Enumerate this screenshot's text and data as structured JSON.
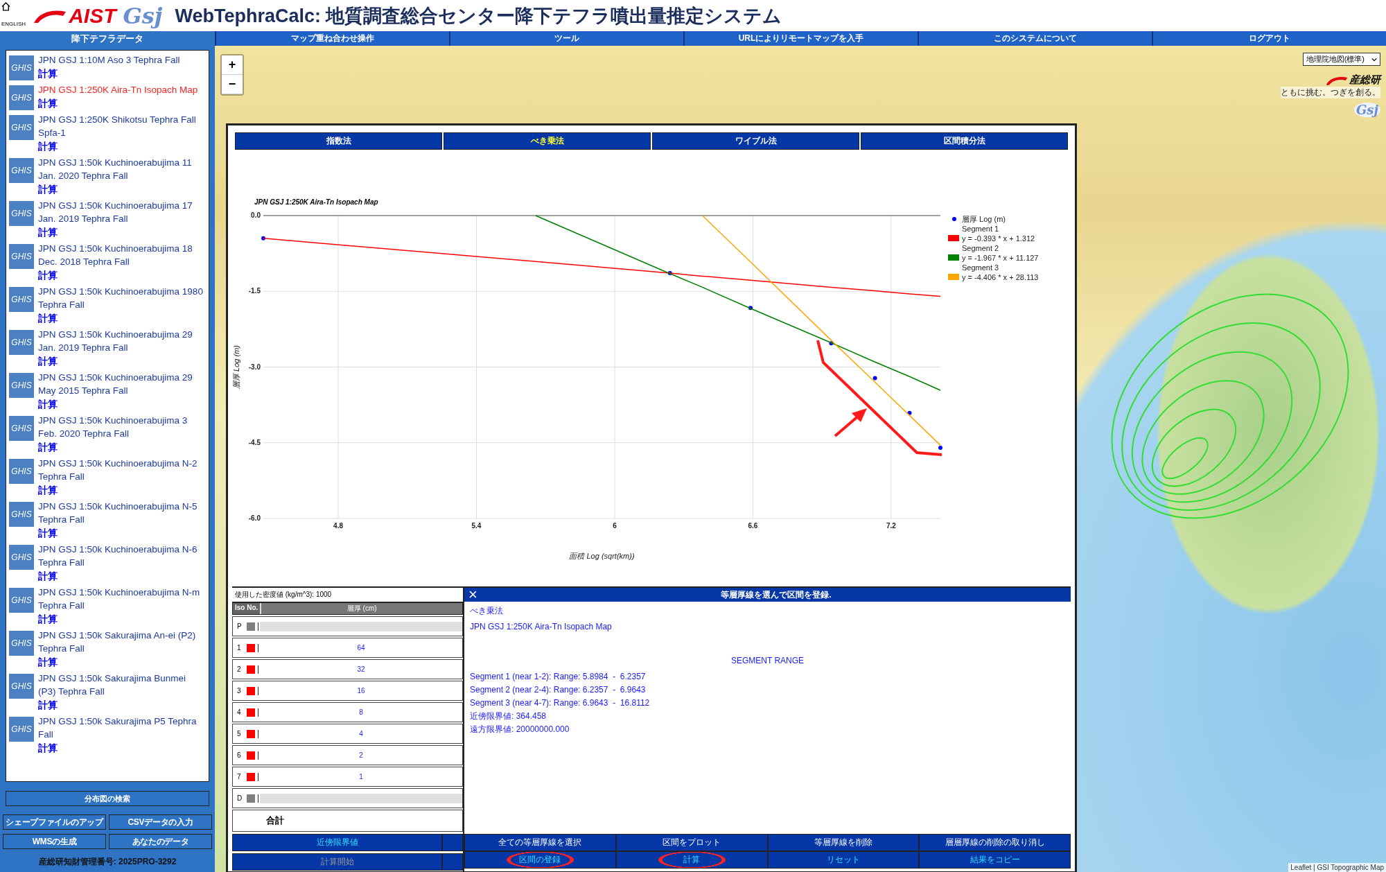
{
  "header": {
    "home_label": "ENGLISH",
    "aist_logo": "AIST",
    "gsj_logo": "Gsj",
    "title": "WebTephraCalc: 地質調査総合センター降下テフラ噴出量推定システム"
  },
  "nav": [
    "マップ重ね合わせ操作",
    "ツール",
    "URLによりリモートマップを入手",
    "このシステムについて",
    "ログアウト"
  ],
  "sidebar": {
    "title": "降下テフラデータ",
    "items": [
      {
        "badge": "GHIS",
        "name": "JPN GSJ 1:10M Aso 3 Tephra Fall",
        "action": "計算",
        "selected": false
      },
      {
        "badge": "GHIS",
        "name": "JPN GSJ 1:250K Aira-Tn Isopach Map",
        "action": "計算",
        "selected": true
      },
      {
        "badge": "GHIS",
        "name": "JPN GSJ 1:250K Shikotsu Tephra Fall Spfa-1",
        "action": "計算",
        "selected": false
      },
      {
        "badge": "GHIS",
        "name": "JPN GSJ 1:50k Kuchinoerabujima 11 Jan. 2020 Tephra Fall",
        "action": "計算",
        "selected": false
      },
      {
        "badge": "GHIS",
        "name": "JPN GSJ 1:50k Kuchinoerabujima 17 Jan. 2019 Tephra Fall",
        "action": "計算",
        "selected": false
      },
      {
        "badge": "GHIS",
        "name": "JPN GSJ 1:50k Kuchinoerabujima 18 Dec. 2018 Tephra Fall",
        "action": "計算",
        "selected": false
      },
      {
        "badge": "GHIS",
        "name": "JPN GSJ 1:50k Kuchinoerabujima 1980 Tephra Fall",
        "action": "計算",
        "selected": false
      },
      {
        "badge": "GHIS",
        "name": "JPN GSJ 1:50k Kuchinoerabujima 29 Jan. 2019 Tephra Fall",
        "action": "計算",
        "selected": false
      },
      {
        "badge": "GHIS",
        "name": "JPN GSJ 1:50k Kuchinoerabujima 29 May 2015 Tephra Fall",
        "action": "計算",
        "selected": false
      },
      {
        "badge": "GHIS",
        "name": "JPN GSJ 1:50k Kuchinoerabujima 3 Feb. 2020 Tephra Fall",
        "action": "計算",
        "selected": false
      },
      {
        "badge": "GHIS",
        "name": "JPN GSJ 1:50k Kuchinoerabujima N-2 Tephra Fall",
        "action": "計算",
        "selected": false
      },
      {
        "badge": "GHIS",
        "name": "JPN GSJ 1:50k Kuchinoerabujima N-5 Tephra Fall",
        "action": "計算",
        "selected": false
      },
      {
        "badge": "GHIS",
        "name": "JPN GSJ 1:50k Kuchinoerabujima N-6 Tephra Fall",
        "action": "計算",
        "selected": false
      },
      {
        "badge": "GHIS",
        "name": "JPN GSJ 1:50k Kuchinoerabujima N-m Tephra Fall",
        "action": "計算",
        "selected": false
      },
      {
        "badge": "GHIS",
        "name": "JPN GSJ 1:50k Sakurajima An-ei (P2) Tephra Fall",
        "action": "計算",
        "selected": false
      },
      {
        "badge": "GHIS",
        "name": "JPN GSJ 1:50k Sakurajima Bunmei (P3) Tephra Fall",
        "action": "計算",
        "selected": false
      },
      {
        "badge": "GHIS",
        "name": "JPN GSJ 1:50k Sakurajima P5 Tephra Fall",
        "action": "計算",
        "selected": false
      }
    ],
    "search_button": "分布図の検索",
    "buttons": [
      "シェープファイルのアップ",
      "CSVデータの入力",
      "WMSの生成",
      "あなたのデータ"
    ],
    "footer": "産総研知財管理番号: 2025PRO-3292"
  },
  "map": {
    "zoom_in": "+",
    "zoom_out": "−",
    "layer_select": "地理院地図(標準)",
    "logo_text": "産総研",
    "logo_tagline": "ともに挑む。つぎを創る。",
    "gsj_logo": "Gsj",
    "attribution": "Leaflet | GSI Topographic Map"
  },
  "dialog": {
    "tabs": [
      {
        "label": "指数法",
        "selected": false
      },
      {
        "label": "べき乗法",
        "selected": true
      },
      {
        "label": "ワイブル法",
        "selected": false
      },
      {
        "label": "区間積分法",
        "selected": false
      }
    ],
    "chart_data": {
      "type": "line",
      "title": "JPN GSJ 1:250K Aira-Tn Isopach Map",
      "xlabel": "面積 Log (sqrt(km))",
      "ylabel": "層厚 Log (m)",
      "grid": true,
      "legend": "right",
      "x": [
        4.475,
        5.657,
        6.24,
        6.381,
        6.59,
        6.94,
        7.13,
        7.28,
        7.414
      ],
      "series": [
        {
          "name": "層厚 Log (m)",
          "color": "#0000ff",
          "type": "scatter",
          "marker": "circle",
          "values": [
            -0.45,
            null,
            -1.14,
            null,
            -1.83,
            -2.53,
            -3.22,
            -3.91,
            -4.6
          ]
        },
        {
          "name": "y = -0.393 * x + 1.312",
          "color": "#ff0000",
          "values": [
            -0.45,
            -0.91,
            -1.14,
            -1.2,
            -1.28,
            -1.42,
            -1.49,
            -1.55,
            -1.6
          ]
        },
        {
          "name": "y = -1.967 * x + 11.127",
          "color": "#008000",
          "values": [
            null,
            0,
            -1.15,
            -1.42,
            -1.84,
            -2.52,
            -2.9,
            -3.19,
            -3.46
          ]
        },
        {
          "name": "y = -4.406 * x + 28.113",
          "color": "#ffa500",
          "values": [
            null,
            null,
            null,
            0,
            -0.92,
            -2.47,
            -3.3,
            -3.96,
            -4.55
          ]
        }
      ],
      "xlim": [
        4.475,
        7.414
      ],
      "ylim": [
        -6,
        0
      ],
      "xticks": [
        4.8,
        5.4,
        6.0,
        6.6,
        7.2
      ],
      "yticks": [
        {
          "value": 0,
          "label": "0.0"
        },
        {
          "value": -1.5,
          "label": "-1.5"
        },
        {
          "value": -3,
          "label": "-3.0"
        },
        {
          "value": -4.5,
          "label": "-4.5"
        },
        {
          "value": -6,
          "label": "-6.0"
        }
      ]
    },
    "legend_headings": [
      "Segment 1",
      "Segment 2",
      "Segment 3"
    ],
    "density_label": "使用した密度値 (kg/m^3): 1000",
    "columns": [
      "Iso No.",
      "層厚 (cm)"
    ],
    "rows": [
      {
        "iso": "P",
        "kind": "limit",
        "color": "#808080"
      },
      {
        "iso": "1",
        "kind": "data",
        "color": "#ff0000",
        "thickness": "64"
      },
      {
        "iso": "2",
        "kind": "data",
        "color": "#ff0000",
        "thickness": "32"
      },
      {
        "iso": "3",
        "kind": "data",
        "color": "#ff0000",
        "thickness": "16"
      },
      {
        "iso": "4",
        "kind": "data",
        "color": "#ff0000",
        "thickness": "8"
      },
      {
        "iso": "5",
        "kind": "data",
        "color": "#ff0000",
        "thickness": "4"
      },
      {
        "iso": "6",
        "kind": "data",
        "color": "#ff0000",
        "thickness": "2"
      },
      {
        "iso": "7",
        "kind": "data",
        "color": "#ff0000",
        "thickness": "1"
      },
      {
        "iso": "D",
        "kind": "limit",
        "color": "#808080"
      }
    ],
    "total_label": "合計",
    "left_buttons": [
      {
        "label": "近傍限界値",
        "disabled": false
      },
      {
        "label": "計算開始",
        "disabled": true
      }
    ],
    "panel": {
      "close": "×",
      "title": "等層厚線を選んで区間を登録.",
      "method": "べき乗法",
      "map_name": "JPN GSJ 1:250K Aira-Tn Isopach Map",
      "range_heading": "SEGMENT RANGE",
      "lines": [
        "Segment 1 (near 1-2): Range: 5.8984  -  6.2357",
        "Segment 2 (near 2-4): Range: 6.2357  -  6.9643",
        "Segment 3 (near 4-7): Range: 6.9643  -  16.8112",
        "近傍限界値: 364.458",
        "遠方限界値: 20000000.000"
      ]
    },
    "panel_buttons": [
      {
        "label": "全ての等層厚線を選択",
        "kind": "tool",
        "highlighted": false
      },
      {
        "label": "区間をプロット",
        "kind": "tool",
        "highlighted": false
      },
      {
        "label": "等層厚線を削除",
        "kind": "tool",
        "highlighted": false
      },
      {
        "label": "層層厚線の削除の取り消し",
        "kind": "tool",
        "highlighted": false
      },
      {
        "label": "区間の登録",
        "kind": "action",
        "highlighted": true
      },
      {
        "label": "計算",
        "kind": "action",
        "highlighted": true
      },
      {
        "label": "リセット",
        "kind": "action",
        "highlighted": false
      },
      {
        "label": "結果をコピー",
        "kind": "action",
        "highlighted": false
      }
    ]
  }
}
